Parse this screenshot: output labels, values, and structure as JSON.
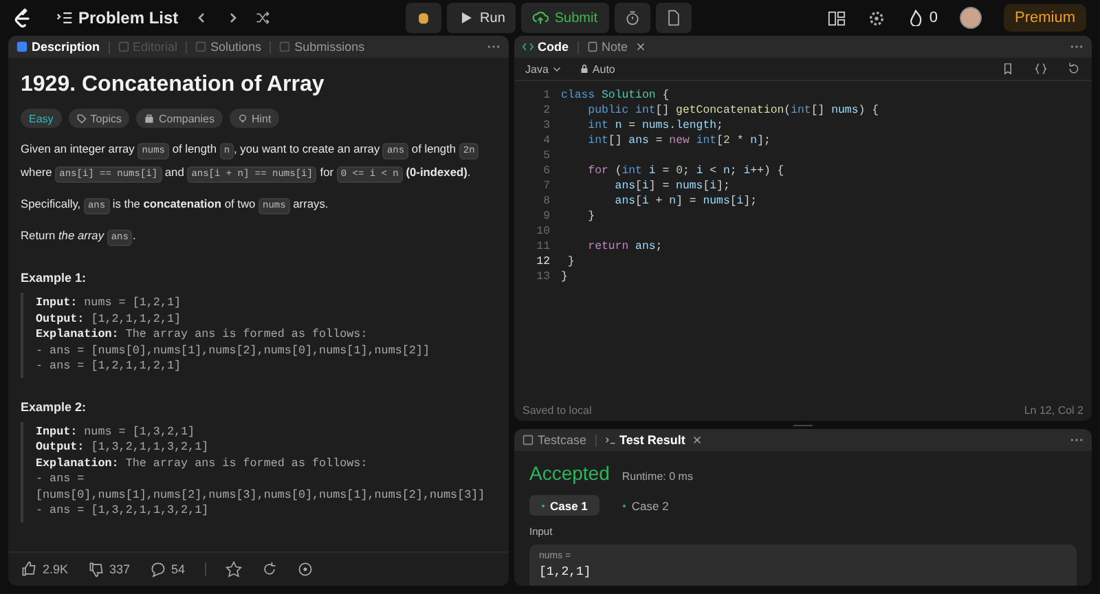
{
  "topbar": {
    "problem_list": "Problem List",
    "run": "Run",
    "submit": "Submit",
    "streak": "0",
    "premium": "Premium"
  },
  "description": {
    "tabs": [
      {
        "label": "Description",
        "selected": true,
        "disabled": false
      },
      {
        "label": "Editorial",
        "selected": false,
        "disabled": true
      },
      {
        "label": "Solutions",
        "selected": false,
        "disabled": false
      },
      {
        "label": "Submissions",
        "selected": false,
        "disabled": false
      }
    ],
    "title": "1929. Concatenation of Array",
    "tags": [
      {
        "kind": "difficulty",
        "label": "Easy"
      },
      {
        "kind": "topics",
        "label": "Topics"
      },
      {
        "kind": "companies",
        "label": "Companies"
      },
      {
        "kind": "hint",
        "label": "Hint"
      }
    ],
    "paragraphs": [
      [
        {
          "kind": "text",
          "text": "Given an integer array "
        },
        {
          "kind": "code",
          "text": "nums"
        },
        {
          "kind": "text",
          "text": " of length "
        },
        {
          "kind": "code",
          "text": "n"
        },
        {
          "kind": "text",
          "text": ", you want to create an array "
        },
        {
          "kind": "code",
          "text": "ans"
        },
        {
          "kind": "text",
          "text": " of length "
        },
        {
          "kind": "code",
          "text": "2n"
        },
        {
          "kind": "text",
          "text": " where "
        },
        {
          "kind": "code",
          "text": "ans[i] == nums[i]"
        },
        {
          "kind": "text",
          "text": " and "
        },
        {
          "kind": "code",
          "text": "ans[i + n] == nums[i]"
        },
        {
          "kind": "text",
          "text": " for "
        },
        {
          "kind": "code",
          "text": "0 <= i < n"
        },
        {
          "kind": "text",
          "text": " **(0-indexed)**."
        }
      ],
      [
        {
          "kind": "text",
          "text": "Specifically, "
        },
        {
          "kind": "code",
          "text": "ans"
        },
        {
          "kind": "text",
          "text": " is the **concatenation** of two "
        },
        {
          "kind": "code",
          "text": "nums"
        },
        {
          "kind": "text",
          "text": " arrays."
        }
      ],
      [
        {
          "kind": "text",
          "text": "Return *the array* "
        },
        {
          "kind": "code",
          "text": "ans"
        },
        {
          "kind": "text",
          "text": "."
        }
      ]
    ],
    "examples": [
      {
        "title": "Example 1:",
        "lines": [
          {
            "label": "Input:",
            "text": "nums = [1,2,1]"
          },
          {
            "label": "Output:",
            "text": "[1,2,1,1,2,1]"
          },
          {
            "label": "Explanation:",
            "text": "The array ans is formed as follows:"
          },
          {
            "text": "- ans = [nums[0],nums[1],nums[2],nums[0],nums[1],nums[2]]"
          },
          {
            "text": "- ans = [1,2,1,1,2,1]"
          }
        ]
      },
      {
        "title": "Example 2:",
        "lines": [
          {
            "label": "Input:",
            "text": "nums = [1,3,2,1]"
          },
          {
            "label": "Output:",
            "text": "[1,3,2,1,1,3,2,1]"
          },
          {
            "label": "Explanation:",
            "text": "The array ans is formed as follows:"
          },
          {
            "text": "- ans ="
          },
          {
            "text": "[nums[0],nums[1],nums[2],nums[3],nums[0],nums[1],nums[2],nums[3]]"
          },
          {
            "text": "- ans = [1,3,2,1,1,3,2,1]"
          }
        ]
      }
    ],
    "footer": {
      "likes": "2.9K",
      "dislikes": "337",
      "comments": "54"
    }
  },
  "editor": {
    "tabs": [
      {
        "label": "Code",
        "selected": true,
        "closable": false
      },
      {
        "label": "Note",
        "selected": false,
        "closable": true
      }
    ],
    "language": "Java",
    "mode": "Auto",
    "lines": [
      {
        "no": "1",
        "current": false,
        "tokens": [
          {
            "kind": "keyword",
            "text": "class"
          },
          {
            "kind": "type",
            "text": " Solution"
          },
          {
            "kind": "plain",
            "text": " {"
          }
        ]
      },
      {
        "no": "2",
        "current": false,
        "tokens": [
          {
            "kind": "keyword",
            "text": "    public int"
          },
          {
            "kind": "plain",
            "text": "[] "
          },
          {
            "kind": "function",
            "text": "getConcatenation"
          },
          {
            "kind": "plain",
            "text": "("
          },
          {
            "kind": "keyword",
            "text": "int"
          },
          {
            "kind": "plain",
            "text": "[] "
          },
          {
            "kind": "variable",
            "text": "nums"
          },
          {
            "kind": "plain",
            "text": ") {"
          }
        ]
      },
      {
        "no": "3",
        "current": false,
        "tokens": [
          {
            "kind": "keyword",
            "text": "    int"
          },
          {
            "kind": "variable",
            "text": " n"
          },
          {
            "kind": "plain",
            "text": " = "
          },
          {
            "kind": "variable",
            "text": "nums"
          },
          {
            "kind": "plain",
            "text": "."
          },
          {
            "kind": "variable",
            "text": "length"
          },
          {
            "kind": "plain",
            "text": ";"
          }
        ]
      },
      {
        "no": "4",
        "current": false,
        "tokens": [
          {
            "kind": "keyword",
            "text": "    int"
          },
          {
            "kind": "plain",
            "text": "[] "
          },
          {
            "kind": "variable",
            "text": "ans"
          },
          {
            "kind": "plain",
            "text": " = "
          },
          {
            "kind": "control",
            "text": "new"
          },
          {
            "kind": "keyword",
            "text": " int"
          },
          {
            "kind": "plain",
            "text": "["
          },
          {
            "kind": "number",
            "text": "2"
          },
          {
            "kind": "plain",
            "text": " * "
          },
          {
            "kind": "variable",
            "text": "n"
          },
          {
            "kind": "plain",
            "text": "];"
          }
        ]
      },
      {
        "no": "5",
        "current": false
      },
      {
        "no": "6",
        "current": false,
        "tokens": [
          {
            "kind": "control",
            "text": "    for"
          },
          {
            "kind": "plain",
            "text": " ("
          },
          {
            "kind": "keyword",
            "text": "int"
          },
          {
            "kind": "variable",
            "text": " i"
          },
          {
            "kind": "plain",
            "text": " = "
          },
          {
            "kind": "number",
            "text": "0"
          },
          {
            "kind": "plain",
            "text": "; "
          },
          {
            "kind": "variable",
            "text": "i"
          },
          {
            "kind": "plain",
            "text": " < "
          },
          {
            "kind": "variable",
            "text": "n"
          },
          {
            "kind": "plain",
            "text": "; "
          },
          {
            "kind": "variable",
            "text": "i"
          },
          {
            "kind": "plain",
            "text": "++) {"
          }
        ]
      },
      {
        "no": "7",
        "current": false,
        "tokens": [
          {
            "kind": "variable",
            "text": "        ans"
          },
          {
            "kind": "plain",
            "text": "["
          },
          {
            "kind": "variable",
            "text": "i"
          },
          {
            "kind": "plain",
            "text": "] = "
          },
          {
            "kind": "variable",
            "text": "nums"
          },
          {
            "kind": "plain",
            "text": "["
          },
          {
            "kind": "variable",
            "text": "i"
          },
          {
            "kind": "plain",
            "text": "];"
          }
        ]
      },
      {
        "no": "8",
        "current": false,
        "tokens": [
          {
            "kind": "variable",
            "text": "        ans"
          },
          {
            "kind": "plain",
            "text": "["
          },
          {
            "kind": "variable",
            "text": "i"
          },
          {
            "kind": "plain",
            "text": " + "
          },
          {
            "kind": "variable",
            "text": "n"
          },
          {
            "kind": "plain",
            "text": "] = "
          },
          {
            "kind": "variable",
            "text": "nums"
          },
          {
            "kind": "plain",
            "text": "["
          },
          {
            "kind": "variable",
            "text": "i"
          },
          {
            "kind": "plain",
            "text": "];"
          }
        ]
      },
      {
        "no": "9",
        "current": false,
        "tokens": [
          {
            "kind": "plain",
            "text": "    }"
          }
        ]
      },
      {
        "no": "10",
        "current": false
      },
      {
        "no": "11",
        "current": false,
        "tokens": [
          {
            "kind": "control",
            "text": "    return"
          },
          {
            "kind": "variable",
            "text": " ans"
          },
          {
            "kind": "plain",
            "text": ";"
          }
        ]
      },
      {
        "no": "12",
        "current": true,
        "tokens": [
          {
            "kind": "plain",
            "text": " }"
          }
        ]
      },
      {
        "no": "13",
        "current": false,
        "tokens": [
          {
            "kind": "plain",
            "text": "}"
          }
        ]
      }
    ],
    "status_left": "Saved to local",
    "status_right": "Ln 12, Col 2"
  },
  "results": {
    "tabs": [
      {
        "label": "Testcase",
        "selected": false,
        "closable": false
      },
      {
        "label": "Test Result",
        "selected": true,
        "closable": true
      }
    ],
    "verdict": "Accepted",
    "runtime": "Runtime: 0 ms",
    "cases": [
      {
        "label": "Case 1",
        "selected": true
      },
      {
        "label": "Case 2",
        "selected": false
      }
    ],
    "input_label": "Input",
    "var_name": "nums =",
    "var_value": "[1,2,1]"
  }
}
